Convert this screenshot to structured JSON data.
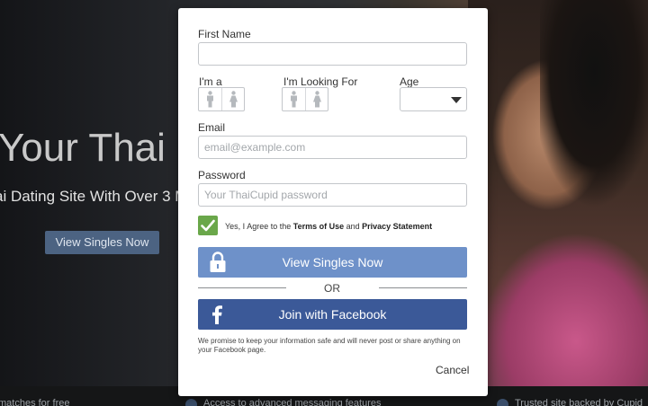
{
  "background": {
    "hero_title": "Your Thai L",
    "hero_subtitle": "ai Dating Site With Over 3 M",
    "hero_button": "View Singles Now",
    "bottom_items": [
      "matches for free",
      "Access to advanced messaging features",
      "Trusted site backed by Cupid"
    ]
  },
  "form": {
    "first_name_label": "First Name",
    "first_name_value": "",
    "im_a_label": "I'm a",
    "looking_for_label": "I'm Looking For",
    "age_label": "Age",
    "age_value": "",
    "email_label": "Email",
    "email_placeholder": "email@example.com",
    "password_label": "Password",
    "password_placeholder": "Your ThaiCupid password",
    "agree_prefix": "Yes, I Agree to the ",
    "terms_link": "Terms of Use",
    "agree_and": " and ",
    "privacy_link": "Privacy Statement",
    "agree_checked": true,
    "view_singles_button": "View Singles Now",
    "or_text": "OR",
    "facebook_button": "Join with Facebook",
    "promise_text": "We promise to keep your information safe and will never post or share anything on your Facebook page.",
    "cancel_label": "Cancel"
  },
  "colors": {
    "checkbox": "#6aa74a",
    "view_button": "#6e91c9",
    "facebook_button": "#3b5998",
    "hero_button": "#4c6382"
  },
  "icons": {
    "male": "male-icon",
    "female": "female-icon",
    "lock": "lock-icon",
    "facebook": "facebook-icon",
    "check": "check-icon",
    "dropdown": "chevron-down-icon"
  }
}
